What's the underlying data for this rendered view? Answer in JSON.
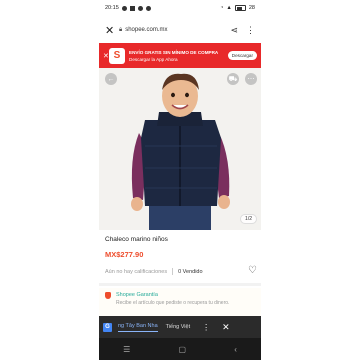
{
  "status_bar": {
    "time": "20:15",
    "battery": "28"
  },
  "browser": {
    "url": "shopee.com.mx"
  },
  "banner": {
    "title": "ENVÍO GRATIS SIN MÍNIMO DE COMPRA",
    "subtitle": "Descargar la App Ahora",
    "download_label": "Descargar"
  },
  "product": {
    "image_counter": "1/2",
    "title": "Chaleco marino niños",
    "price": "MX$277.90",
    "ratings": "Aún no hay calificaciones",
    "sold": "0 Vendido"
  },
  "guarantee": {
    "title": "Shopee Garantía",
    "text": "Recibe el artículo que pediste o recupera tu dinero."
  },
  "translate_bar": {
    "active_language": "ng Tây Ban Nha",
    "other_language": "Tiếng Việt"
  },
  "colors": {
    "brand": "#ee4d2d",
    "banner": "#e8292a",
    "guarantee": "#26aa99"
  }
}
